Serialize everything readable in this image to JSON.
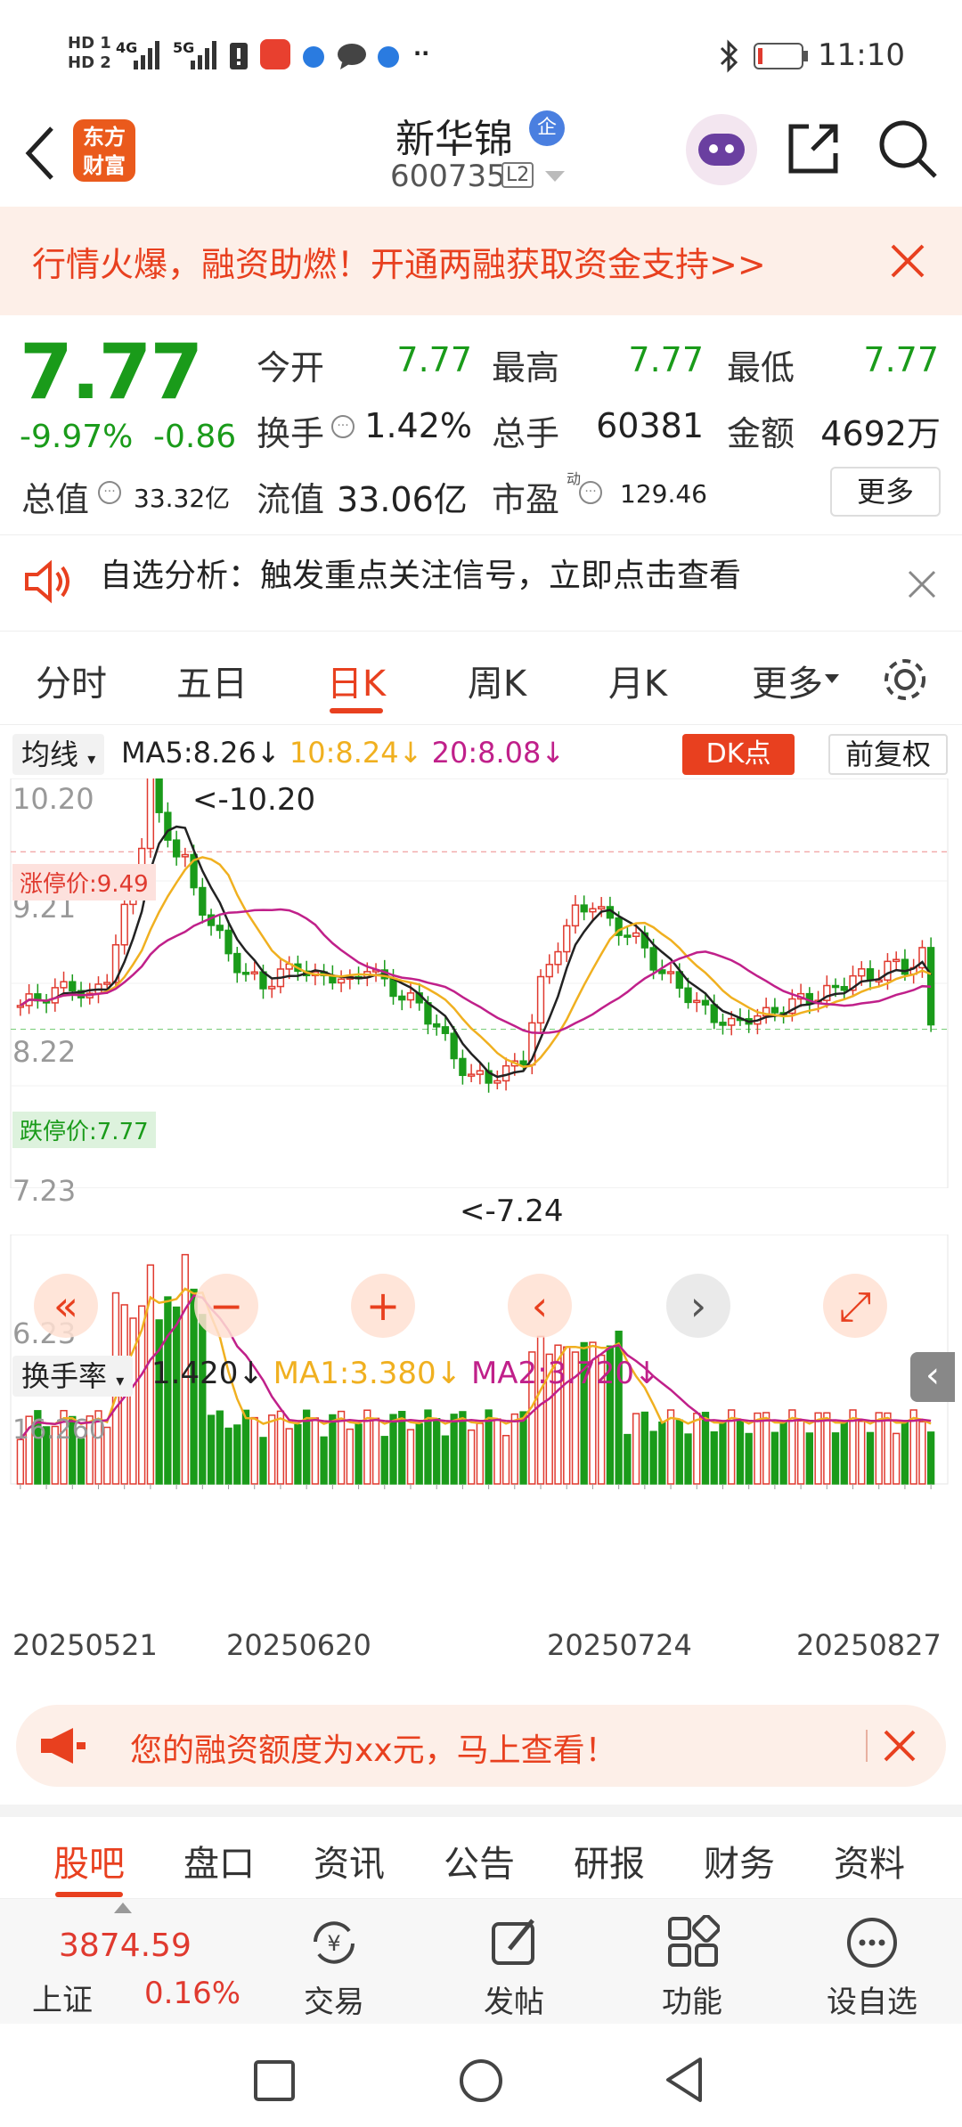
{
  "status": {
    "time": "11:10",
    "hd1": "HD 1",
    "hd2": "HD 2",
    "net1": "4G",
    "net2": "5G",
    "more": "··"
  },
  "header": {
    "logo_line1": "东方",
    "logo_line2": "财富",
    "stock_name": "新华锦",
    "badge": "企",
    "code": "600735",
    "level": "L2"
  },
  "promo": {
    "text": "行情火爆，融资助燃！开通两融获取资金支持>>"
  },
  "quote": {
    "price": "7.77",
    "change_pct": "-9.97%",
    "change": "-0.86",
    "open_label": "今开",
    "open": "7.77",
    "high_label": "最高",
    "high": "7.77",
    "low_label": "最低",
    "low": "7.77",
    "turnover_label": "换手",
    "turnover": "1.42%",
    "volume_label": "总手",
    "volume": "60381",
    "amount_label": "金额",
    "amount": "4692万",
    "mktcap_label": "总值",
    "mktcap": "33.32亿",
    "float_label": "流值",
    "float": "33.06亿",
    "pe_label": "市盈",
    "pe_sup": "动",
    "pe": "129.46",
    "more_label": "更多"
  },
  "signal": {
    "text": "自选分析：触发重点关注信号，立即点击查看"
  },
  "tabs": [
    "分时",
    "五日",
    "日K",
    "周K",
    "月K",
    "更多"
  ],
  "active_tab": 2,
  "chart_data": {
    "type": "candlestick",
    "indicator_label": "均线",
    "ma5": "MA5:8.26",
    "ma10": "10:8.24",
    "ma20": "20:8.08",
    "dk_label": "DK点",
    "adjust_label": "前复权",
    "y_ticks": [
      "10.20",
      "9.21",
      "8.22",
      "7.23",
      "6.23"
    ],
    "limit_up_label": "涨停价:9.49",
    "limit_down_label": "跌停价:7.77",
    "limit_up": 9.49,
    "limit_down": 7.77,
    "high_annotation": "<-10.20",
    "low_annotation": "<-7.24",
    "ylim": [
      6.23,
      10.2
    ],
    "colors": {
      "up": "#e03a2f",
      "down": "#1a9b1a",
      "ma5": "#222222",
      "ma10": "#f0b020",
      "ma20": "#c0208a"
    },
    "sub_indicator_label": "换手率",
    "sub_value": "1.420",
    "sub_ma1": "MA1:3.380",
    "sub_ma2": "MA2:3.720",
    "sub_ylim_label": "16.260",
    "sub_ymax": 16.26,
    "x_labels": [
      "20250521",
      "20250620",
      "20250724",
      "20250827"
    ]
  },
  "ad": {
    "text": "您的融资额度为xx元，马上查看！"
  },
  "subtabs": [
    "股吧",
    "盘口",
    "资讯",
    "公告",
    "研报",
    "财务",
    "资料"
  ],
  "active_subtab": 0,
  "bottom": {
    "index_value": "3874.59",
    "index_name": "上证",
    "index_change": "0.16%",
    "trade": "交易",
    "post": "发帖",
    "features": "功能",
    "watchlist": "设自选"
  }
}
